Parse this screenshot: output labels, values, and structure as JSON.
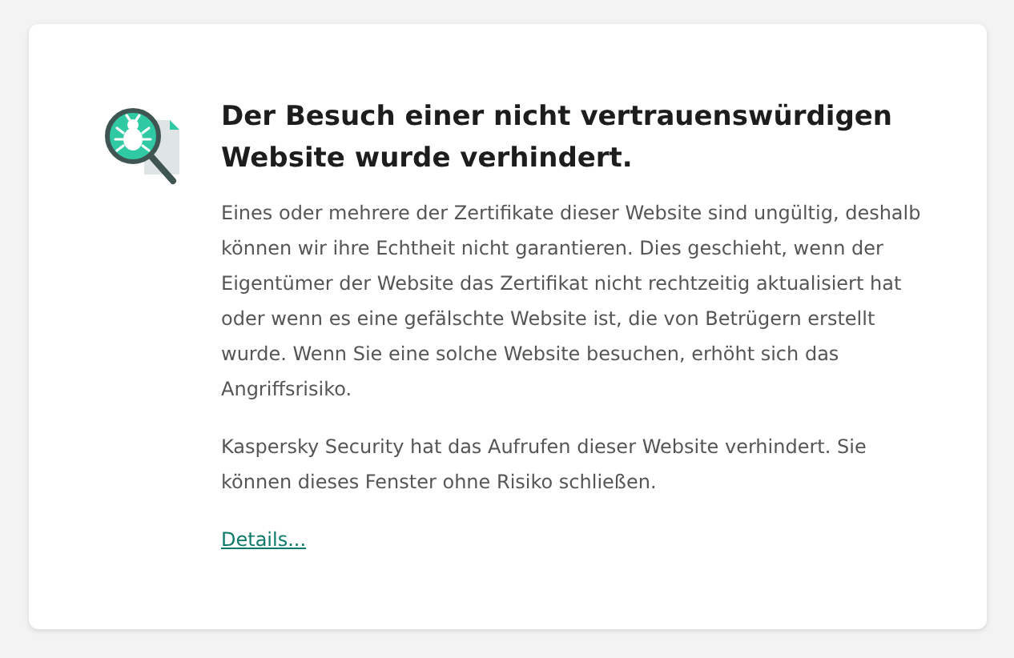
{
  "title": "Der Besuch einer nicht vertrauenswürdigen Website wurde verhindert.",
  "paragraphs": [
    "Eines oder mehrere der Zertifikate dieser Website sind ungültig, deshalb können wir ihre Echtheit nicht garantieren. Dies geschieht, wenn der Eigentümer der Website das Zertifikat nicht rechtzeitig aktualisiert hat oder wenn es eine gefälschte Website ist, die von Betrügern erstellt wurde. Wenn Sie eine solche Website besuchen, erhöht sich das Angriffsrisiko.",
    "Kaspersky Security hat das Aufrufen dieser Website verhindert. Sie können dieses Fenster ohne Risiko schließen."
  ],
  "link": "Details..."
}
